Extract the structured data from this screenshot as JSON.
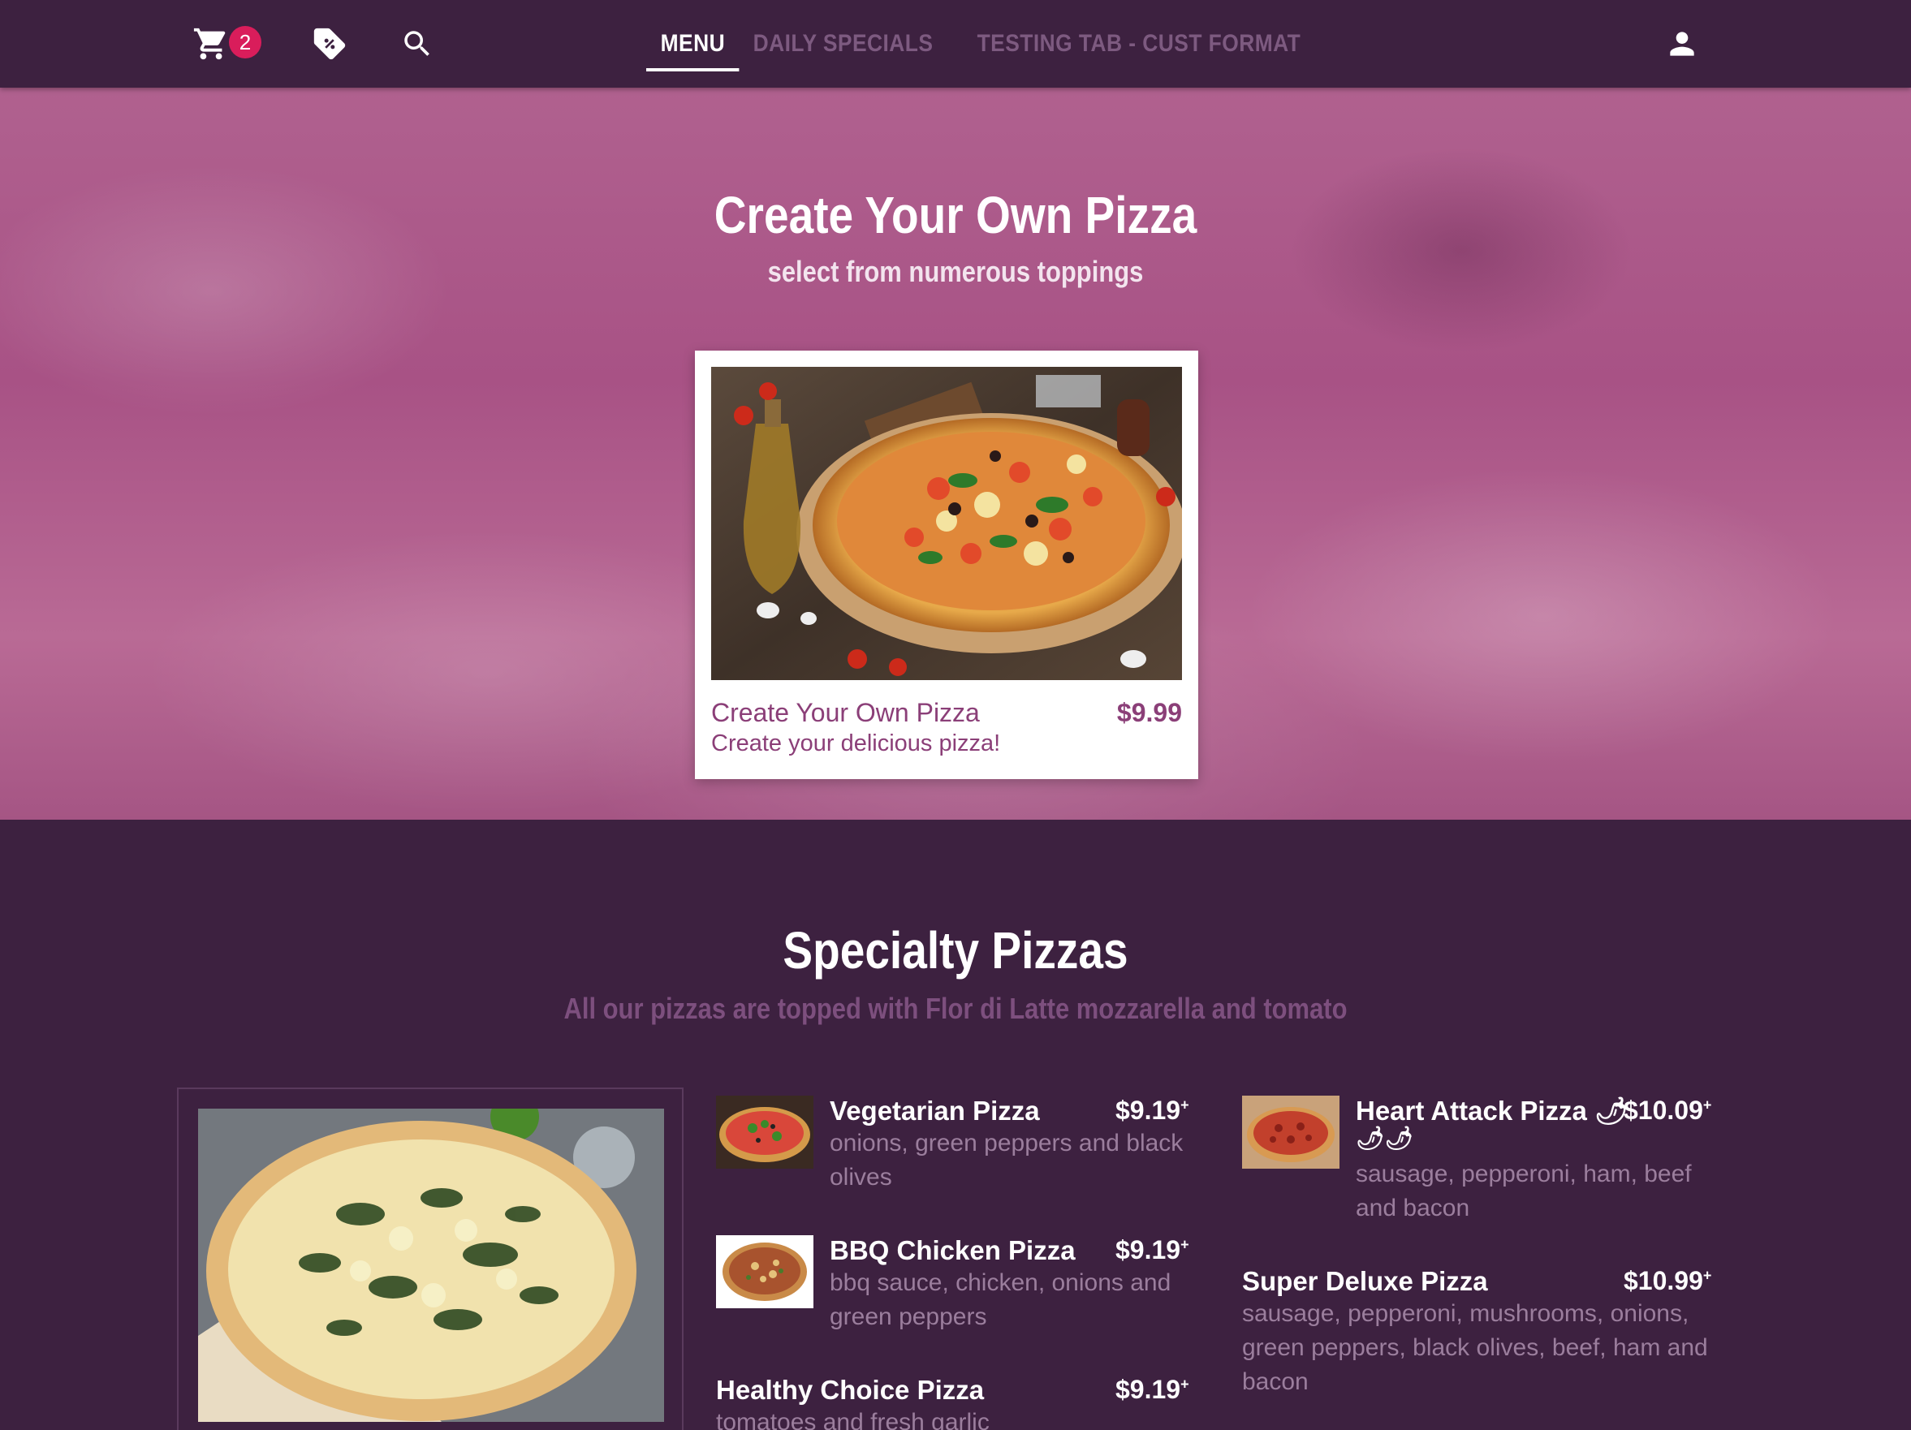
{
  "nav": {
    "cart_count": "2",
    "tabs": [
      {
        "label": "MENU",
        "active": true
      },
      {
        "label": "DAILY SPECIALS",
        "active": false
      },
      {
        "label": "TESTING TAB - CUST FORMAT",
        "active": false
      }
    ]
  },
  "hero": {
    "title": "Create Your Own Pizza",
    "subtitle": "select from numerous toppings",
    "card": {
      "name": "Create Your Own Pizza",
      "price": "$9.99",
      "description": "Create your delicious pizza!"
    }
  },
  "specialty": {
    "title": "Specialty Pizzas",
    "subtitle": "All our pizzas are topped with Flor di Latte mozzarella and tomato",
    "items": [
      {
        "name": "Vegetarian Pizza",
        "price": "$9.19",
        "plus": "+",
        "description": "onions, green peppers and black olives"
      },
      {
        "name": "BBQ Chicken Pizza",
        "price": "$9.19",
        "plus": "+",
        "description": "bbq sauce, chicken, onions and green peppers"
      },
      {
        "name": "Healthy Choice Pizza",
        "price": "$9.19",
        "plus": "+",
        "description": "tomatoes and fresh garlic"
      },
      {
        "name": "Heart Attack Pizza",
        "price": "$10.09",
        "plus": "+",
        "description": "sausage, pepperoni, ham, beef and bacon",
        "spicy_icons": "🌶"
      },
      {
        "name": "Super Deluxe Pizza",
        "price": "$10.99",
        "plus": "+",
        "description": "sausage, pepperoni, mushrooms, onions, green peppers, black olives, beef, ham and bacon"
      }
    ]
  },
  "colors": {
    "nav_bg": "#3d2140",
    "badge": "#d91d5b",
    "card_text": "#8b3f78",
    "muted_text": "#9b7e9d"
  }
}
